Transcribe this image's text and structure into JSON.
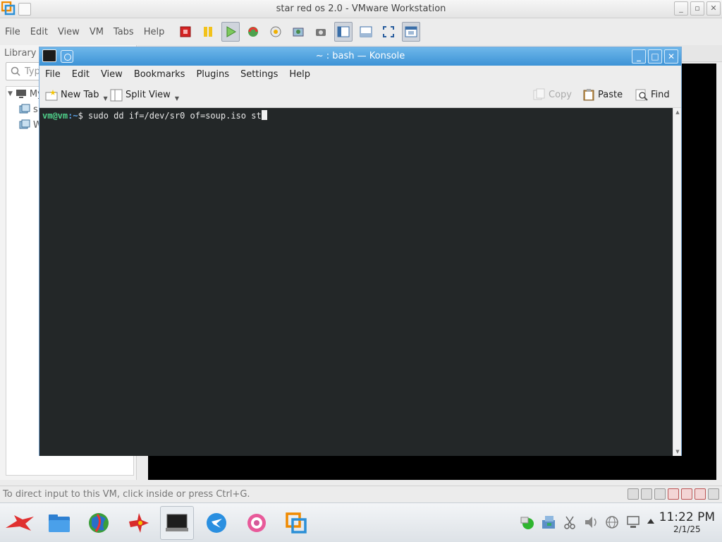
{
  "vmware": {
    "title": "star red os 2.0 - VMware Workstation",
    "menu": [
      "File",
      "Edit",
      "View",
      "VM",
      "Tabs",
      "Help"
    ],
    "library_label": "Library",
    "search_placeholder": "Typ",
    "tree": [
      "My",
      "s",
      "W"
    ],
    "status_message": "To direct input to this VM, click inside or press Ctrl+G."
  },
  "konsole": {
    "title": "~ : bash — Konsole",
    "menu": [
      "File",
      "Edit",
      "View",
      "Bookmarks",
      "Plugins",
      "Settings",
      "Help"
    ],
    "toolbar": {
      "new_tab": "New Tab",
      "split_view": "Split View",
      "copy": "Copy",
      "paste": "Paste",
      "find": "Find"
    },
    "terminal": {
      "user_host": "vm@vm",
      "path": ":~",
      "prompt_symbol": "$",
      "command": " sudo dd if=/dev/sr0 of=soup.iso st"
    }
  },
  "taskbar": {
    "clock_time": "11:22 PM",
    "clock_date": "2/1/25"
  }
}
